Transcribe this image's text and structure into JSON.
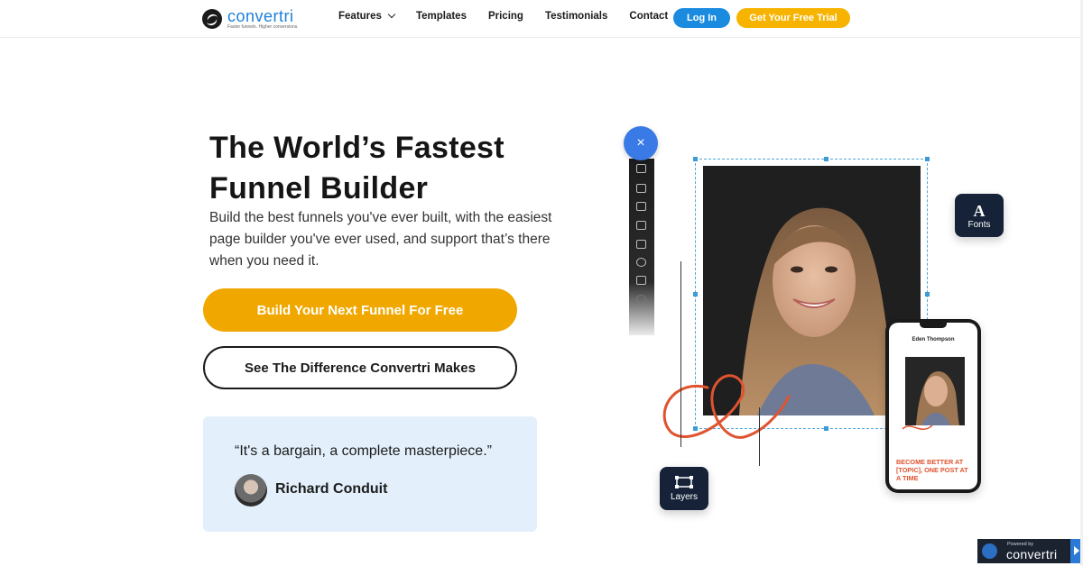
{
  "nav": {
    "logo_word": "convertri",
    "logo_tagline": "Faster funnels. Higher conversions.",
    "links": [
      "Features",
      "Templates",
      "Pricing",
      "Testimonials",
      "Contact"
    ],
    "login_label": "Log In",
    "trial_label": "Get Your Free Trial"
  },
  "hero": {
    "headline_line1": "The World’s Fastest",
    "headline_line2": "Funnel Builder",
    "subheading": "Build the best funnels you've ever built, with the easiest page builder you've ever used, and support that’s there when you need it.",
    "primary_cta": "Build Your Next Funnel For Free",
    "secondary_cta": "See The Difference Convertri Makes"
  },
  "testimonial": {
    "quote": "“It's a bargain, a complete masterpiece.”",
    "author": "Richard Conduit"
  },
  "editor_mock": {
    "close_symbol": "×",
    "fonts_glyph": "A",
    "fonts_label": "Fonts",
    "layers_label": "Layers",
    "phone_name": "Eden Thompson",
    "phone_cta": "BECOME BETTER AT [TOPIC], ONE POST AT A TIME",
    "toolbar_icons": [
      "puzzle-icon",
      "text-icon",
      "image-icon",
      "checkbox-icon",
      "box-icon",
      "video-icon",
      "form-icon",
      "timer-icon"
    ]
  },
  "badge": {
    "powered_by": "Powered by",
    "word": "convertri"
  },
  "colors": {
    "brand_blue": "#1b8be0",
    "brand_orange": "#f0a800",
    "card_navy": "#152238",
    "quote_bg": "#e3effb",
    "scribble": "#e0532f"
  }
}
